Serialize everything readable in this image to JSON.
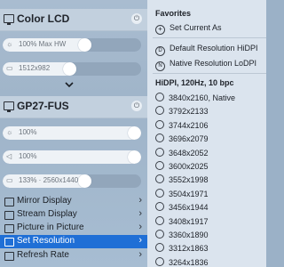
{
  "display1": {
    "name": "Color LCD",
    "brightness_label": "100% Max HW",
    "brightness_level": 0.6,
    "resolution_label": "1512x982",
    "resolution_level": 0.48
  },
  "display2": {
    "name": "GP27-FUS",
    "slider1_label": "100%",
    "slider1_level": 1.0,
    "slider2_label": "100%",
    "slider2_level": 1.0,
    "resolution_label": "133% · 2560x1440",
    "resolution_level": 0.6
  },
  "menu": [
    {
      "label": "Mirror Display"
    },
    {
      "label": "Stream Display"
    },
    {
      "label": "Picture in Picture"
    },
    {
      "label": "Set Resolution"
    },
    {
      "label": "Refresh Rate"
    }
  ],
  "favorites": {
    "heading": "Favorites",
    "items": [
      {
        "label": "Set Current As"
      },
      {
        "label": "Default Resolution HiDPI"
      },
      {
        "label": "Native Resolution LoDPI"
      }
    ]
  },
  "hidpi": {
    "heading": "HiDPI, 120Hz, 10 bpc",
    "items": [
      "3840x2160, Native",
      "3792x2133",
      "3744x2106",
      "3696x2079",
      "3648x2052",
      "3600x2025",
      "3552x1998",
      "3504x1971",
      "3456x1944",
      "3408x1917",
      "3360x1890",
      "3312x1863",
      "3264x1836"
    ]
  }
}
